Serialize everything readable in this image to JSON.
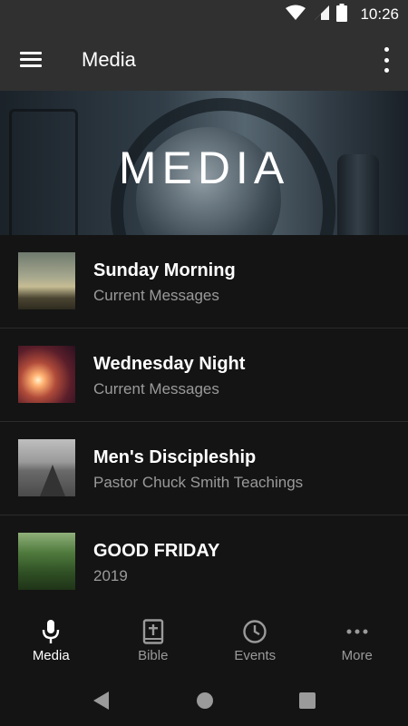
{
  "status_bar": {
    "time": "10:26",
    "icons": [
      "wifi-icon",
      "cell-signal-icon",
      "battery-icon"
    ]
  },
  "app_bar": {
    "title": "Media",
    "menu_icon": "hamburger-menu-icon",
    "overflow_icon": "more-vert-icon"
  },
  "hero": {
    "title": "MEDIA"
  },
  "list": {
    "items": [
      {
        "title": "Sunday Morning",
        "subtitle": "Current Messages"
      },
      {
        "title": "Wednesday Night",
        "subtitle": "Current Messages"
      },
      {
        "title": "Men's Discipleship",
        "subtitle": "Pastor Chuck Smith Teachings"
      },
      {
        "title": "GOOD FRIDAY",
        "subtitle": "2019"
      }
    ]
  },
  "bottom_nav": {
    "items": [
      {
        "label": "Media",
        "icon": "microphone-icon",
        "active": true
      },
      {
        "label": "Bible",
        "icon": "bible-icon",
        "active": false
      },
      {
        "label": "Events",
        "icon": "clock-icon",
        "active": false
      },
      {
        "label": "More",
        "icon": "more-horiz-icon",
        "active": false
      }
    ]
  },
  "system_nav": {
    "icons": [
      "back-icon",
      "home-icon",
      "recents-icon"
    ]
  },
  "colors": {
    "background": "#141414",
    "app_bar": "#303030",
    "secondary_text": "#9a9a9a",
    "active": "#ffffff"
  }
}
